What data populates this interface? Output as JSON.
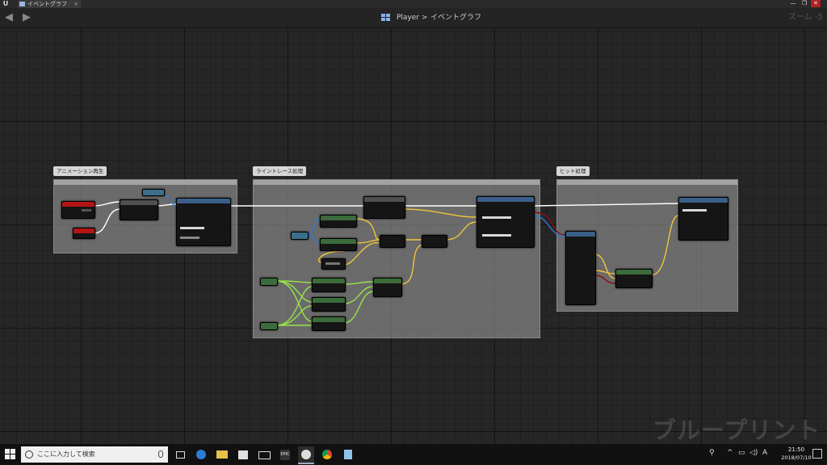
{
  "window": {
    "tab_title": "イベントグラフ",
    "tab_close": "×",
    "min": "—",
    "max": "❐",
    "close": "✕",
    "logo_text": "U"
  },
  "toolbar": {
    "back": "◀",
    "forward": "▶",
    "breadcrumb_root": "Player",
    "breadcrumb_separator": ">",
    "breadcrumb_current": "イベントグラフ",
    "zoom": "ズーム -5"
  },
  "comments": [
    {
      "title": "アニメーション再生"
    },
    {
      "title": "ライントレース処理"
    },
    {
      "title": "ヒット処理"
    }
  ],
  "watermark": "ブループリント",
  "colors": {
    "exec": "#ffffff",
    "event_node": "#b41414",
    "function_node": "#3b5f8a",
    "getter_node": "#3c6c3c",
    "float_wire": "#98e34a",
    "vector_wire": "#f0c53a",
    "object_wire": "#2a7cd8",
    "hit_wire": "#8a0f0f"
  },
  "taskbar": {
    "search_placeholder": "ここに入力して検索",
    "apps": [
      "task-view",
      "edge",
      "file-explorer",
      "store",
      "mail",
      "epic-games-launcher",
      "unreal-engine",
      "chrome",
      "notepad"
    ],
    "epic_label": "EPIC",
    "clock_time": "21:50",
    "clock_date": "2018/07/10"
  }
}
